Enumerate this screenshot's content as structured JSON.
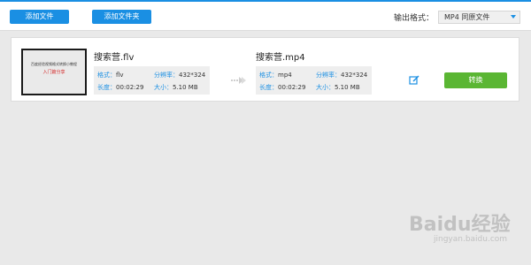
{
  "toolbar": {
    "add_file_label": "添加文件",
    "add_folder_label": "添加文件夹",
    "output_format_label": "输出格式：",
    "output_format_value": "MP4  同原文件"
  },
  "item": {
    "thumbnail": {
      "line1": "百度经验视频格式转换小教程",
      "line2": "入门篇分享"
    },
    "source": {
      "filename": "搜索营.flv",
      "format_key": "格式：",
      "format_val": "flv",
      "resolution_key": "分辨率：",
      "resolution_val": "432*324",
      "duration_key": "长度：",
      "duration_val": "00:02:29",
      "size_key": "大小：",
      "size_val": "5.10 MB"
    },
    "target": {
      "filename": "搜索营.mp4",
      "format_key": "格式：",
      "format_val": "mp4",
      "resolution_key": "分辨率：",
      "resolution_val": "432*324",
      "duration_key": "长度：",
      "duration_val": "00:02:29",
      "size_key": "大小：",
      "size_val": "5.10 MB"
    },
    "convert_label": "转换"
  },
  "watermark": {
    "logo": "Baidu经验",
    "url": "jingyan.baidu.com"
  },
  "colors": {
    "accent": "#1a8fe3",
    "convert": "#5ab633",
    "background": "#e9e9e9"
  }
}
